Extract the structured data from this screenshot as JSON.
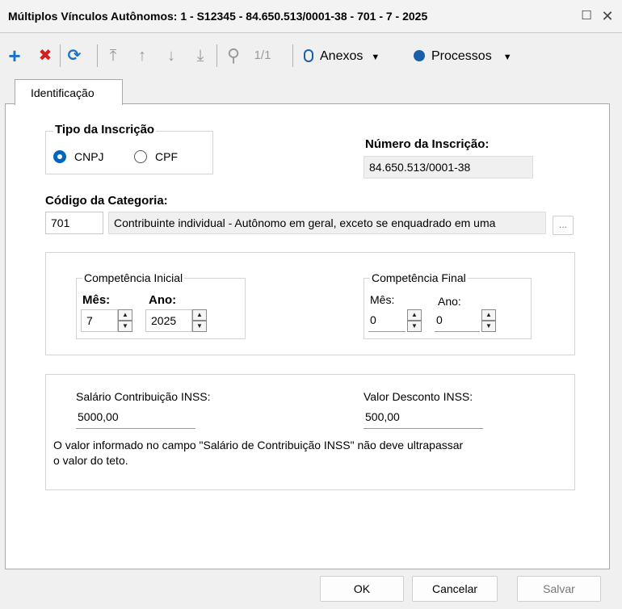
{
  "window": {
    "title": "Múltiplos Vínculos Autônomos: 1 - S12345 - 84.650.513/0001-38 - 701 - 7 - 2025",
    "maximize_glyph": "☐",
    "close_glyph": "✕"
  },
  "toolbar": {
    "add_glyph": "+",
    "delete_glyph": "✖",
    "refresh_glyph": "⟳",
    "first_glyph": "⤒",
    "prev_glyph": "↑",
    "next_glyph": "↓",
    "last_glyph": "⤓",
    "search_glyph": "⚲",
    "record_counter": "1/1",
    "attachments_label": "Anexos",
    "processes_label": "Processos",
    "dropdown_glyph": "▼",
    "colors": {
      "add": "#1a73c8",
      "delete": "#d02020",
      "refresh": "#1a73c8"
    }
  },
  "tabs": [
    {
      "label": "Identificação"
    }
  ],
  "form": {
    "tipo_inscricao": {
      "legend": "Tipo da Inscrição",
      "options": [
        {
          "label": "CNPJ",
          "checked": true
        },
        {
          "label": "CPF",
          "checked": false
        }
      ]
    },
    "numero_inscricao": {
      "label": "Número da Inscrição:",
      "value": "84.650.513/0001-38"
    },
    "categoria": {
      "label": "Código da Categoria:",
      "code": "701",
      "description": "Contribuinte individual - Autônomo em geral, exceto se enquadrado em uma",
      "lookup_label": "..."
    },
    "competencia_inicial": {
      "legend": "Competência Inicial",
      "mes_label": "Mês:",
      "mes_value": "7",
      "ano_label": "Ano:",
      "ano_value": "2025"
    },
    "competencia_final": {
      "legend": "Competência Final",
      "mes_label": "Mês:",
      "mes_value": "0",
      "ano_label": "Ano:",
      "ano_value": "0"
    },
    "salario": {
      "label": "Salário Contribuição INSS:",
      "value": "5000,00"
    },
    "desconto": {
      "label": "Valor Desconto INSS:",
      "value": "500,00"
    },
    "note_line1": "O valor informado no campo \"Salário de Contribuição INSS\" não deve ultrapassar",
    "note_line2": "o valor do teto."
  },
  "footer": {
    "ok_label": "OK",
    "cancel_label": "Cancelar",
    "save_label": "Salvar"
  },
  "spinner": {
    "up_glyph": "▲",
    "down_glyph": "▼"
  }
}
